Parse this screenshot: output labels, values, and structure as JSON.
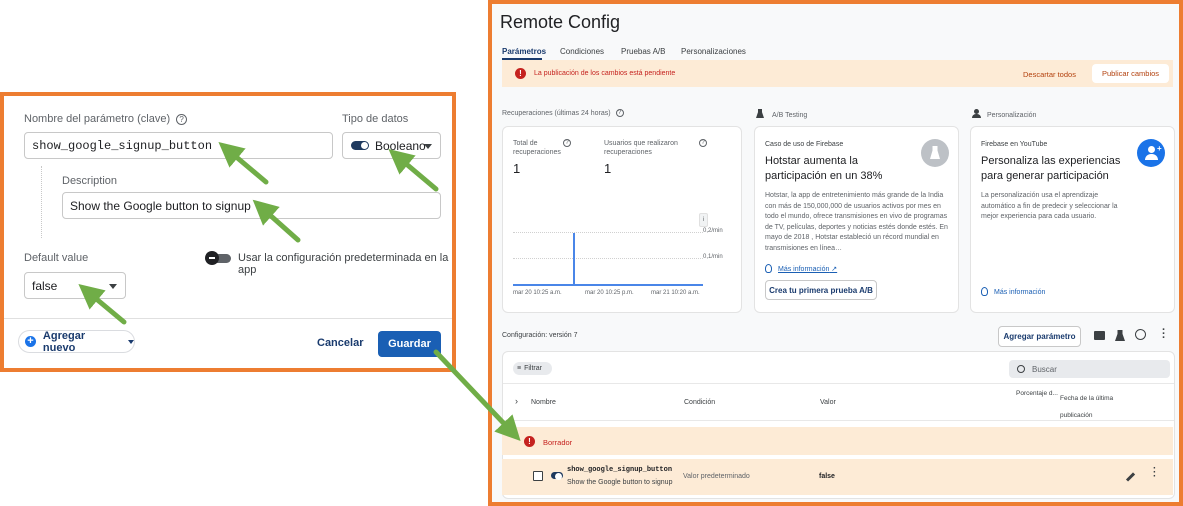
{
  "left": {
    "param_label": "Nombre del parámetro (clave)",
    "param_value": "show_google_signup_button",
    "type_label": "Tipo de datos",
    "type_value": "Booleano",
    "desc_label": "Description",
    "desc_value": "Show the Google button to signup",
    "default_label": "Default value",
    "use_default_label": "Usar la configuración predeterminada en la app",
    "default_value": "false",
    "add_new": "Agregar nuevo",
    "cancel": "Cancelar",
    "save": "Guardar",
    "help_glyph": "?"
  },
  "right": {
    "title": "Remote Config",
    "tabs": [
      "Parámetros",
      "Condiciones",
      "Pruebas A/B",
      "Personalizaciones"
    ],
    "banner": {
      "message": "La publicación de los cambios está pendiente",
      "discard": "Descartar todos",
      "publish": "Publicar cambios"
    },
    "fetches": {
      "section_title": "Recuperaciones (últimas 24 horas)",
      "total_label": "Total de recuperaciones",
      "total_value": "1",
      "users_label": "Usuarios que realizaron recuperaciones",
      "users_value": "1",
      "y_ticks": [
        "0,2/min",
        "0,1/min"
      ],
      "x_ticks": [
        "mar 20 10:25 a.m.",
        "mar 20 10:25 p.m.",
        "mar 21 10:20 a.m."
      ]
    },
    "ab": {
      "section_title": "A/B Testing",
      "eyebrow": "Caso de uso de Firebase",
      "headline": "Hotstar aumenta la participación en un 38%",
      "body": "Hotstar, la app de entretenimiento más grande de la India con más de 150,000,000 de usuarios activos por mes en todo el mundo, ofrece transmisiones en vivo de programas de TV, películas, deportes y noticias estés donde estés. En mayo de 2018 , Hotstar estableció un récord mundial en transmisiones en línea…",
      "more_info": "Más información",
      "create": "Crea tu primera prueba A/B"
    },
    "personalization": {
      "section_title": "Personalización",
      "eyebrow": "Firebase en YouTube",
      "headline": "Personaliza las experiencias para generar participación",
      "body": "La personalización usa el aprendizaje automático a fin de predecir y seleccionar la mejor experiencia para cada usuario.",
      "more_info": "Más información"
    },
    "config_version": "Configuración: versión 7",
    "add_param": "Agregar parámetro",
    "filter": "Filtrar",
    "search_placeholder": "Buscar",
    "columns": {
      "name": "Nombre",
      "condition": "Condición",
      "value": "Valor",
      "percent": "Porcentaje d...",
      "date": "Fecha de la última publicación"
    },
    "draft_label": "Borrador",
    "row": {
      "key": "show_google_signup_button",
      "description": "Show the Google button to signup",
      "condition": "Valor predeterminado",
      "value": "false"
    },
    "accent_orange": "#ED7D31",
    "arrow_green": "#70AD47"
  }
}
